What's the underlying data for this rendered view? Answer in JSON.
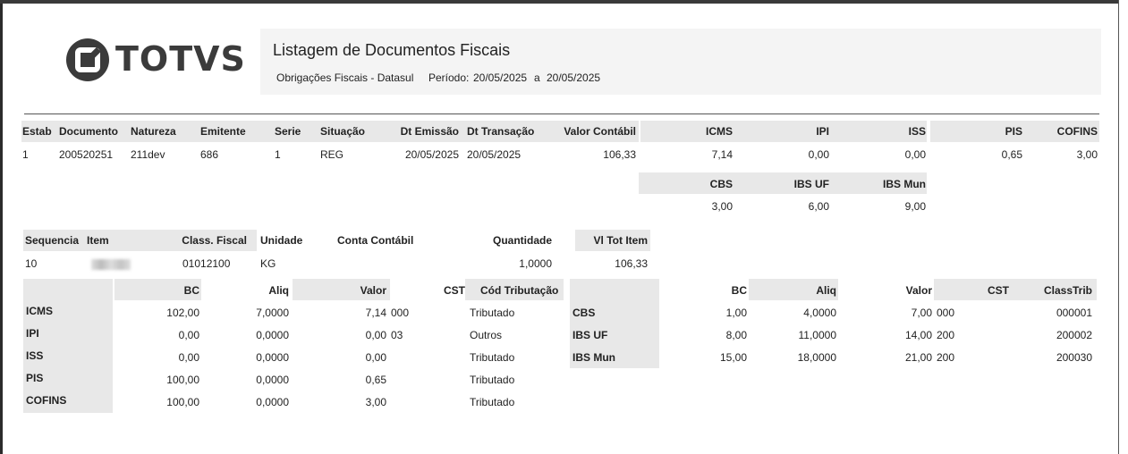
{
  "header": {
    "logo_text": "TOTVS",
    "title": "Listagem de Documentos Fiscais",
    "subtitle": "Obrigações Fiscais - Datasul",
    "period_label": "Período:",
    "period_start": "20/05/2025",
    "period_sep": "a",
    "period_end": "20/05/2025"
  },
  "doc": {
    "headers": [
      "Estab",
      "Documento",
      "Natureza",
      "Emitente",
      "Serie",
      "Situação",
      "Dt Emissão",
      "Dt Transação",
      "Valor Contábil",
      "ICMS",
      "IPI",
      "ISS",
      "PIS",
      "COFINS"
    ],
    "row": [
      "1",
      "200520251",
      "211dev",
      "686",
      "1",
      "REG",
      "20/05/2025",
      "20/05/2025",
      "106,33",
      "7,14",
      "0,00",
      "0,00",
      "0,65",
      "3,00"
    ],
    "extra_headers": [
      "CBS",
      "IBS UF",
      "IBS Mun"
    ],
    "extra_row": [
      "3,00",
      "6,00",
      "9,00"
    ]
  },
  "item": {
    "headers": [
      "Sequencia",
      "Item",
      "Class. Fiscal",
      "Unidade",
      "Conta Contábil",
      "Quantidade",
      "Vl Tot Item"
    ],
    "row": [
      "10",
      "",
      "01012100",
      "KG",
      "",
      "1,0000",
      "106,33"
    ]
  },
  "taxes_left": {
    "headers": [
      "BC",
      "Aliq",
      "Valor",
      "CST",
      "Cód Tributação"
    ],
    "rows": [
      [
        "ICMS",
        "102,00",
        "7,0000",
        "7,14",
        "000",
        "Tributado"
      ],
      [
        "IPI",
        "0,00",
        "0,0000",
        "0,00",
        "03",
        "Outros"
      ],
      [
        "ISS",
        "0,00",
        "0,0000",
        "0,00",
        "",
        "Tributado"
      ],
      [
        "PIS",
        "100,00",
        "0,0000",
        "0,65",
        "",
        "Tributado"
      ],
      [
        "COFINS",
        "100,00",
        "0,0000",
        "3,00",
        "",
        "Tributado"
      ]
    ]
  },
  "taxes_right": {
    "headers": [
      "BC",
      "Aliq",
      "Valor",
      "CST",
      "ClassTrib"
    ],
    "rows": [
      [
        "CBS",
        "1,00",
        "4,0000",
        "7,00",
        "000",
        "000001"
      ],
      [
        "IBS UF",
        "8,00",
        "11,0000",
        "14,00",
        "200",
        "200002"
      ],
      [
        "IBS Mun",
        "15,00",
        "18,0000",
        "21,00",
        "200",
        "200030"
      ]
    ]
  },
  "colors": {
    "header_bg": "#e8e8e8",
    "page_bg": "#ffffff",
    "logo": "#3b3b3b"
  }
}
